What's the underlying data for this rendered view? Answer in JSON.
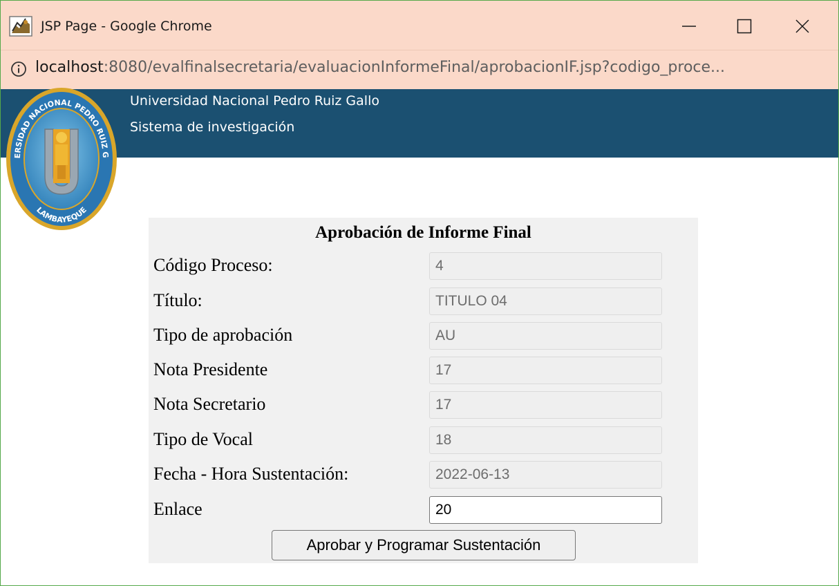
{
  "window": {
    "title": "JSP Page - Google Chrome"
  },
  "address": {
    "host": "localhost",
    "path": ":8080/evalfinalsecretaria/evaluacionInformeFinal/aprobacionIF.jsp?codigo_proce..."
  },
  "header": {
    "university": "Universidad Nacional Pedro Ruiz Gallo",
    "system": "Sistema de investigación"
  },
  "logo": {
    "text_top": "UNIVERSIDAD NACIONAL PEDRO RUIZ GALLO",
    "text_bottom": "LAMBAYEQUE"
  },
  "form": {
    "title": "Aprobación de Informe Final",
    "fields": [
      {
        "label": "Código Proceso:",
        "value": "4"
      },
      {
        "label": "Título:",
        "value": "TITULO 04"
      },
      {
        "label": "Tipo de aprobación",
        "value": "AU"
      },
      {
        "label": "Nota Presidente",
        "value": "17"
      },
      {
        "label": "Nota Secretario",
        "value": "17"
      },
      {
        "label": "Tipo de Vocal",
        "value": "18"
      },
      {
        "label": "Fecha - Hora Sustentación:",
        "value": "2022-06-13"
      },
      {
        "label": "Enlace",
        "value": "20"
      }
    ],
    "submit_label": "Aprobar y Programar Sustentación"
  },
  "colors": {
    "titlebar": "#fbd9c9",
    "banner": "#1b5071",
    "panel": "#f1f1f1"
  }
}
